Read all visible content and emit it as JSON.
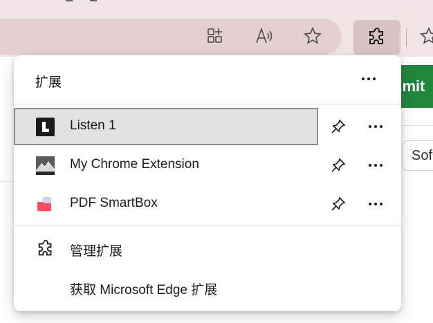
{
  "toolbar": {
    "app_icon": "grid-plus-icon",
    "read_aloud_icon": "read-aloud-icon",
    "favorite_icon": "star-icon",
    "extensions_icon": "puzzle-icon"
  },
  "page": {
    "button_text": "nmit",
    "field_text": "Sof",
    "accent_color": "#1f883d"
  },
  "extensions_menu": {
    "title": "扩展",
    "items": [
      {
        "label": "Listen 1",
        "icon": "listen1-logo-icon",
        "pinned": false,
        "selected": true
      },
      {
        "label": "My Chrome Extension",
        "icon": "mountain-logo-icon",
        "pinned": false,
        "selected": false
      },
      {
        "label": "PDF SmartBox",
        "icon": "pdf-folder-icon",
        "pinned": false,
        "selected": false
      }
    ],
    "manage_label": "管理扩展",
    "get_label": "获取 Microsoft Edge 扩展"
  }
}
